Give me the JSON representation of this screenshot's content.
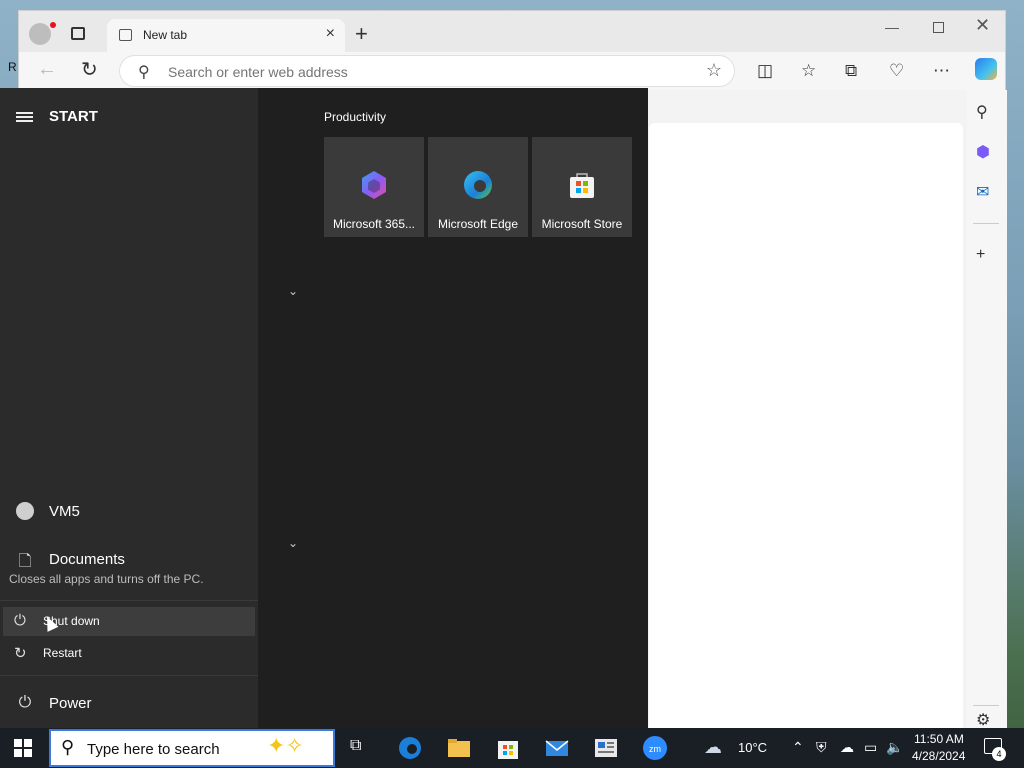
{
  "desktop": {
    "edge_text": "R"
  },
  "browser": {
    "tab_title": "New tab",
    "address_placeholder": "Search or enter web address"
  },
  "start_menu": {
    "title": "START",
    "user_name": "VM5",
    "documents_label": "Documents",
    "tooltip": "Closes all apps and turns off the PC.",
    "power_options": [
      {
        "label": "Shut down",
        "icon": "power-icon"
      },
      {
        "label": "Restart",
        "icon": "restart-icon"
      }
    ],
    "power_label": "Power",
    "group_title": "Productivity",
    "tiles": [
      {
        "label": "Microsoft 365...",
        "icon": "microsoft-365-icon"
      },
      {
        "label": "Microsoft Edge",
        "icon": "edge-icon"
      },
      {
        "label": "Microsoft Store",
        "icon": "store-icon"
      }
    ]
  },
  "taskbar": {
    "search_placeholder": "Type here to search",
    "weather_temp": "10°C",
    "time": "11:50 AM",
    "date": "4/28/2024",
    "notification_count": "4",
    "accent_color": "#3b7ad8"
  }
}
